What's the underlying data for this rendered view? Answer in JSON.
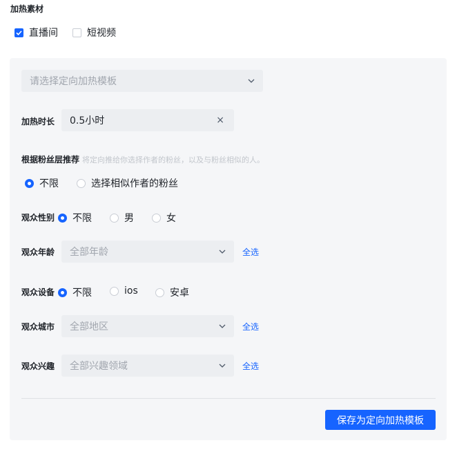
{
  "section_title": "加热素材",
  "material_options": [
    {
      "label": "直播间",
      "checked": true
    },
    {
      "label": "短视频",
      "checked": false
    }
  ],
  "template_select": {
    "placeholder": "请选择定向加热模板",
    "icon": "chevron-down-icon"
  },
  "duration": {
    "label": "加热时长",
    "value": "0.5小时",
    "clear_icon": "close-icon",
    "clear_glyph": "×"
  },
  "fans": {
    "label": "根据粉丝层推荐",
    "hint": "将定向推给你选择作者的粉丝，以及与粉丝相似的人。",
    "options": [
      {
        "label": "不限",
        "selected": true
      },
      {
        "label": "选择相似作者的粉丝",
        "selected": false
      }
    ]
  },
  "gender": {
    "label": "观众性别",
    "options": [
      {
        "label": "不限",
        "selected": true
      },
      {
        "label": "男",
        "selected": false
      },
      {
        "label": "女",
        "selected": false
      }
    ]
  },
  "age": {
    "label": "观众年龄",
    "placeholder": "全部年龄",
    "select_all": "全选"
  },
  "device": {
    "label": "观众设备",
    "options": [
      {
        "label": "不限",
        "selected": true
      },
      {
        "label": "ios",
        "selected": false
      },
      {
        "label": "安卓",
        "selected": false
      }
    ]
  },
  "city": {
    "label": "观众城市",
    "placeholder": "全部地区",
    "select_all": "全选"
  },
  "interest": {
    "label": "观众兴趣",
    "placeholder": "全部兴趣领域",
    "select_all": "全选"
  },
  "save_button": "保存为定向加热模板",
  "colors": {
    "accent": "#1664ff",
    "panel_bg": "#f5f6f8",
    "input_bg": "#eceef1"
  }
}
